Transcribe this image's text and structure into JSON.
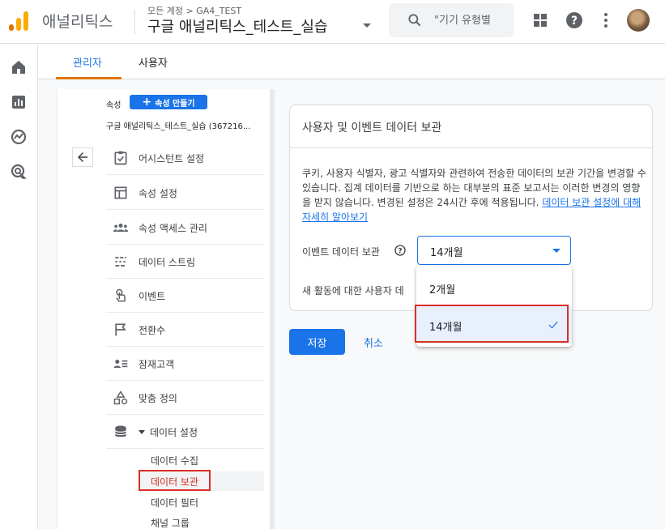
{
  "app": {
    "name": "애널리틱스"
  },
  "header": {
    "breadcrumb": "모든 계정 > GA4_TEST",
    "property_title": "구글 애널리틱스_테스트_실습",
    "search_placeholder": "\"기기 유형별",
    "icons": [
      "apps-grid-icon",
      "help-icon",
      "more-vert-icon",
      "avatar"
    ]
  },
  "rail": {
    "icons": [
      "home-icon",
      "reports-icon",
      "explore-icon",
      "advertising-icon"
    ]
  },
  "tabs": [
    {
      "label": "관리자",
      "active": true
    },
    {
      "label": "사용자",
      "active": false
    }
  ],
  "nav": {
    "property_label": "속성",
    "create_button": "속성 만들기",
    "property_name": "구글 애널리틱스_테스트_실습 (367216...",
    "items": [
      {
        "label": "어시스턴트 설정",
        "icon": "checklist-icon"
      },
      {
        "label": "속성 설정",
        "icon": "layout-icon"
      },
      {
        "label": "속성 액세스 관리",
        "icon": "people-icon"
      },
      {
        "label": "데이터 스트림",
        "icon": "streams-icon"
      },
      {
        "label": "이벤트",
        "icon": "touch-icon"
      },
      {
        "label": "전환수",
        "icon": "flag-icon"
      },
      {
        "label": "잠재고객",
        "icon": "audience-icon"
      },
      {
        "label": "맞춤 정의",
        "icon": "shapes-icon"
      },
      {
        "label": "데이터 설정",
        "icon": "database-icon"
      }
    ],
    "sub_items": [
      {
        "label": "데이터 수집"
      },
      {
        "label": "데이터 보관",
        "active": true
      },
      {
        "label": "데이터 필터"
      },
      {
        "label": "채널 그룹"
      }
    ]
  },
  "card": {
    "title": "사용자 및 이벤트 데이터 보관",
    "description": "쿠키, 사용자 식별자, 광고 식별자와 관련하여 전송한 데이터의 보관 기간을 변경할 수 있습니다. 집계 데이터를 기반으로 하는 대부분의 표준 보고서는 이러한 변경의 영향을 받지 않습니다. 변경된 설정은 24시간 후에 적용됩니다.",
    "link": "데이터 보관 설정에 대해 자세히 알아보기",
    "event_label": "이벤트 데이터 보관",
    "select_value": "14개월",
    "new_activity_label": "새 활동에 대한 사용자 데"
  },
  "menu": {
    "options": [
      {
        "label": "2개월",
        "selected": false
      },
      {
        "label": "14개월",
        "selected": true
      }
    ]
  },
  "actions": {
    "save": "저장",
    "cancel": "취소"
  },
  "colors": {
    "accent": "#1a73e8",
    "tab_indicator": "#e37400",
    "highlight": "#d93025"
  }
}
